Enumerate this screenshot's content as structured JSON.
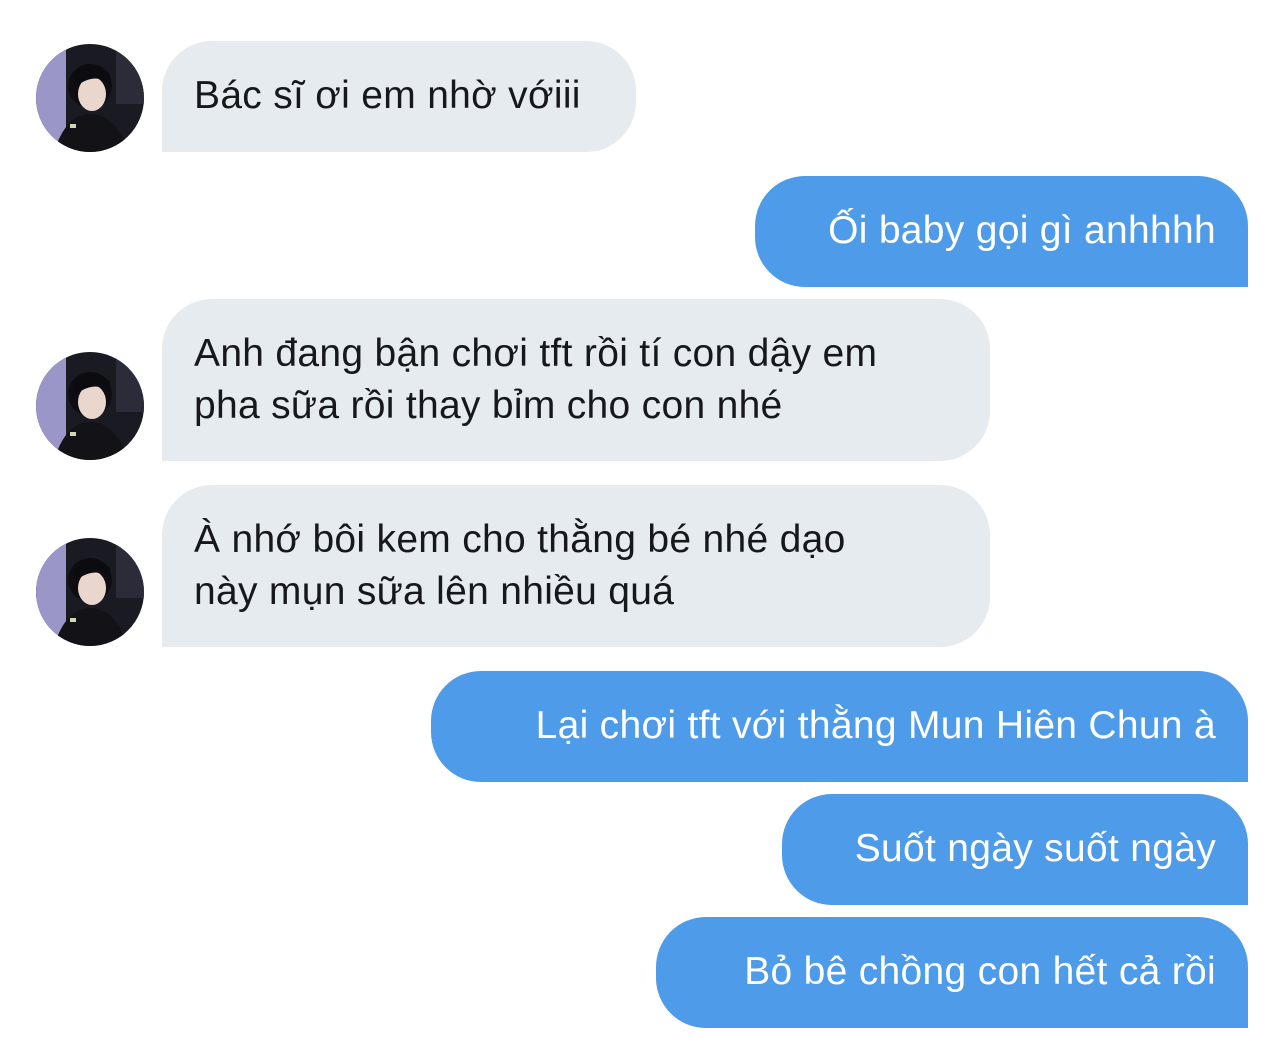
{
  "conversation": {
    "messages": [
      {
        "direction": "incoming",
        "text": "Bác sĩ ơi em nhờ vớiii",
        "has_avatar": true
      },
      {
        "direction": "outgoing",
        "text": "Ối baby gọi gì anhhhh"
      },
      {
        "direction": "incoming",
        "text": "Anh đang bận chơi tft rồi tí con dậy em\npha sữa rồi thay bỉm cho con nhé",
        "has_avatar": true
      },
      {
        "direction": "incoming",
        "text": "À nhớ bôi kem cho thằng bé nhé dạo\nnày mụn sữa lên nhiều quá",
        "has_avatar": true
      },
      {
        "direction": "outgoing",
        "text": "Lại chơi tft với thằng Mun Hiên Chun à"
      },
      {
        "direction": "outgoing",
        "text": "Suốt ngày suốt ngày"
      },
      {
        "direction": "outgoing",
        "text": "Bỏ bê chồng con hết cả rồi"
      }
    ]
  },
  "colors": {
    "incoming_bubble": "#e6ebef",
    "outgoing_bubble": "#4d9be9",
    "incoming_text": "#16181c",
    "outgoing_text": "#ffffff"
  },
  "icons": {
    "avatar": "user-avatar-photo"
  }
}
